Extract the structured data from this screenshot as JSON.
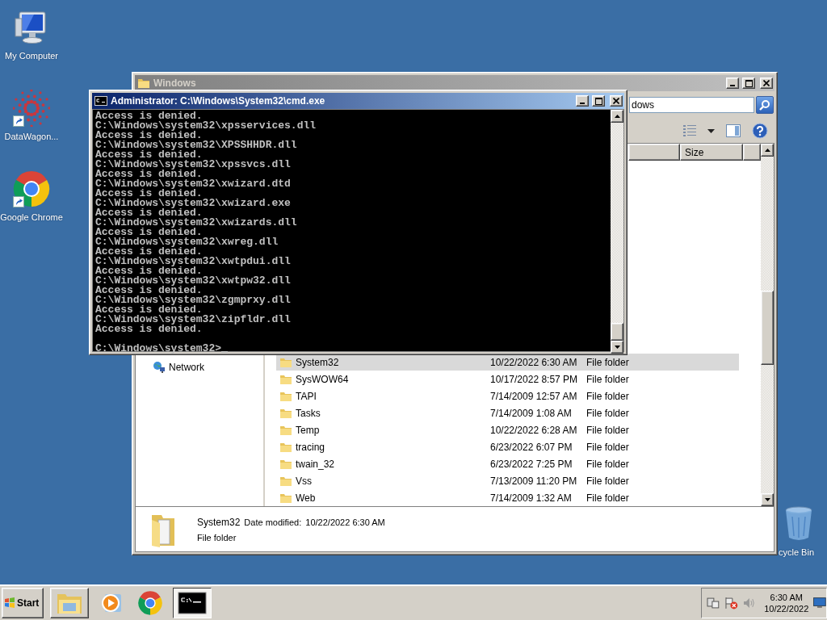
{
  "desktop": {
    "icons": [
      {
        "kind": "computer",
        "label": "My Computer",
        "shortcut": false
      },
      {
        "kind": "datawagon",
        "label": "DataWagon...",
        "shortcut": true
      },
      {
        "kind": "chrome",
        "label": "Google Chrome",
        "shortcut": true
      },
      {
        "kind": "recycle-bin",
        "label": "cycle Bin",
        "shortcut": false
      }
    ]
  },
  "explorer": {
    "title": "Windows",
    "search": {
      "value": "dows"
    },
    "columns": [
      {
        "label": "Size"
      }
    ],
    "nav_items": [
      {
        "label": "Network"
      }
    ],
    "rows": [
      {
        "name": "System32",
        "date": "10/22/2022 6:30 AM",
        "type": "File folder",
        "selected": true
      },
      {
        "name": "SysWOW64",
        "date": "10/17/2022 8:57 PM",
        "type": "File folder",
        "selected": false
      },
      {
        "name": "TAPI",
        "date": "7/14/2009 12:57 AM",
        "type": "File folder",
        "selected": false
      },
      {
        "name": "Tasks",
        "date": "7/14/2009 1:08 AM",
        "type": "File folder",
        "selected": false
      },
      {
        "name": "Temp",
        "date": "10/22/2022 6:28 AM",
        "type": "File folder",
        "selected": false
      },
      {
        "name": "tracing",
        "date": "6/23/2022 6:07 PM",
        "type": "File folder",
        "selected": false
      },
      {
        "name": "twain_32",
        "date": "6/23/2022 7:25 PM",
        "type": "File folder",
        "selected": false
      },
      {
        "name": "Vss",
        "date": "7/13/2009 11:20 PM",
        "type": "File folder",
        "selected": false
      },
      {
        "name": "Web",
        "date": "7/14/2009 1:32 AM",
        "type": "File folder",
        "selected": false
      }
    ],
    "details": {
      "name": "System32",
      "date_label": "Date modified:",
      "date": "10/22/2022 6:30 AM",
      "type": "File folder"
    }
  },
  "cmd": {
    "title": "Administrator: C:\\Windows\\System32\\cmd.exe",
    "lines": [
      "Access is denied.",
      "C:\\Windows\\system32\\xpsservices.dll",
      "Access is denied.",
      "C:\\Windows\\system32\\XPSSHHDR.dll",
      "Access is denied.",
      "C:\\Windows\\system32\\xpssvcs.dll",
      "Access is denied.",
      "C:\\Windows\\system32\\xwizard.dtd",
      "Access is denied.",
      "C:\\Windows\\system32\\xwizard.exe",
      "Access is denied.",
      "C:\\Windows\\system32\\xwizards.dll",
      "Access is denied.",
      "C:\\Windows\\system32\\xwreg.dll",
      "Access is denied.",
      "C:\\Windows\\system32\\xwtpdui.dll",
      "Access is denied.",
      "C:\\Windows\\system32\\xwtpw32.dll",
      "Access is denied.",
      "C:\\Windows\\system32\\zgmprxy.dll",
      "Access is denied.",
      "C:\\Windows\\system32\\zipfldr.dll",
      "Access is denied."
    ],
    "prompt": "C:\\Windows\\system32>"
  },
  "taskbar": {
    "start": "Start",
    "items": [
      {
        "kind": "explorer",
        "running": true,
        "active": false
      },
      {
        "kind": "media-player",
        "running": false,
        "active": false
      },
      {
        "kind": "chrome",
        "running": false,
        "active": false
      },
      {
        "kind": "cmd",
        "running": true,
        "active": true
      }
    ],
    "clock": {
      "time": "6:30 AM",
      "date": "10/22/2022"
    }
  }
}
